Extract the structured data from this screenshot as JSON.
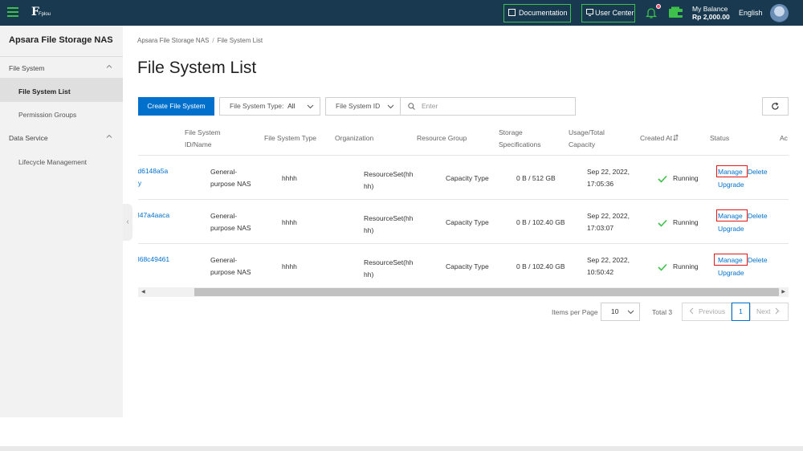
{
  "topbar": {
    "logo_text": "Fplou",
    "documentation_label": "Documentation",
    "user_center_label": "User Center",
    "balance_label": "My Balance",
    "balance_value": "Rp 2,000.00",
    "language": "English",
    "accent_color": "#3ec14a",
    "bar_color": "#18394f"
  },
  "sidebar": {
    "title": "Apsara File Storage NAS",
    "groups": [
      {
        "label": "File System",
        "items": [
          "File System List",
          "Permission Groups"
        ]
      },
      {
        "label": "Data Service",
        "items": [
          "Lifecycle Management"
        ]
      }
    ],
    "active_item": "File System List"
  },
  "breadcrumb": {
    "root": "Apsara File Storage NAS",
    "separator": "/",
    "current": "File System List"
  },
  "page_title": "File System List",
  "toolbar": {
    "create_label": "Create File System",
    "type_filter_label": "File System Type:",
    "type_filter_value": "All",
    "id_filter_label": "File System ID",
    "search_placeholder": "Enter",
    "refresh_icon": "refresh-icon"
  },
  "table": {
    "columns": {
      "id_name_1": "File System",
      "id_name_2": "ID/Name",
      "type": "File System Type",
      "organization": "Organization",
      "resource_group": "Resource Group",
      "storage_1": "Storage",
      "storage_2": "Specifications",
      "usage_1": "Usage/Total",
      "usage_2": "Capacity",
      "created": "Created At",
      "status": "Status",
      "actions": "Ac"
    },
    "rows": [
      {
        "id": ":d6148a5a",
        "name": "ry",
        "type_1": "General-",
        "type_2": "purpose NAS",
        "organization": "hhhh",
        "rg_1": "ResourceSet(hh",
        "rg_2": "hh)",
        "storage": "Capacity Type",
        "usage": "0 B / 512 GB",
        "created_1": "Sep 22, 2022,",
        "created_2": "17:05:36",
        "status": "Running",
        "manage": "Manage",
        "delete": "Delete",
        "upgrade": "Upgrade"
      },
      {
        "id": "347a4aaca",
        "name": "",
        "type_1": "General-",
        "type_2": "purpose NAS",
        "organization": "hhhh",
        "rg_1": "ResourceSet(hh",
        "rg_2": "hh)",
        "storage": "Capacity Type",
        "usage": "0 B / 102.40 GB",
        "created_1": "Sep 22, 2022,",
        "created_2": "17:03:07",
        "status": "Running",
        "manage": "Manage",
        "delete": "Delete",
        "upgrade": "Upgrade"
      },
      {
        "id": "368c49461",
        "name": "l",
        "type_1": "General-",
        "type_2": "purpose NAS",
        "organization": "hhhh",
        "rg_1": "ResourceSet(hh",
        "rg_2": "hh)",
        "storage": "Capacity Type",
        "usage": "0 B / 102.40 GB",
        "created_1": "Sep 22, 2022,",
        "created_2": "10:50:42",
        "status": "Running",
        "manage": "Manage",
        "delete": "Delete",
        "upgrade": "Upgrade"
      }
    ]
  },
  "pagination": {
    "items_per_page_label": "Items per Page",
    "items_per_page": "10",
    "total": "Total 3",
    "previous": "Previous",
    "current_page": "1",
    "next": "Next"
  }
}
